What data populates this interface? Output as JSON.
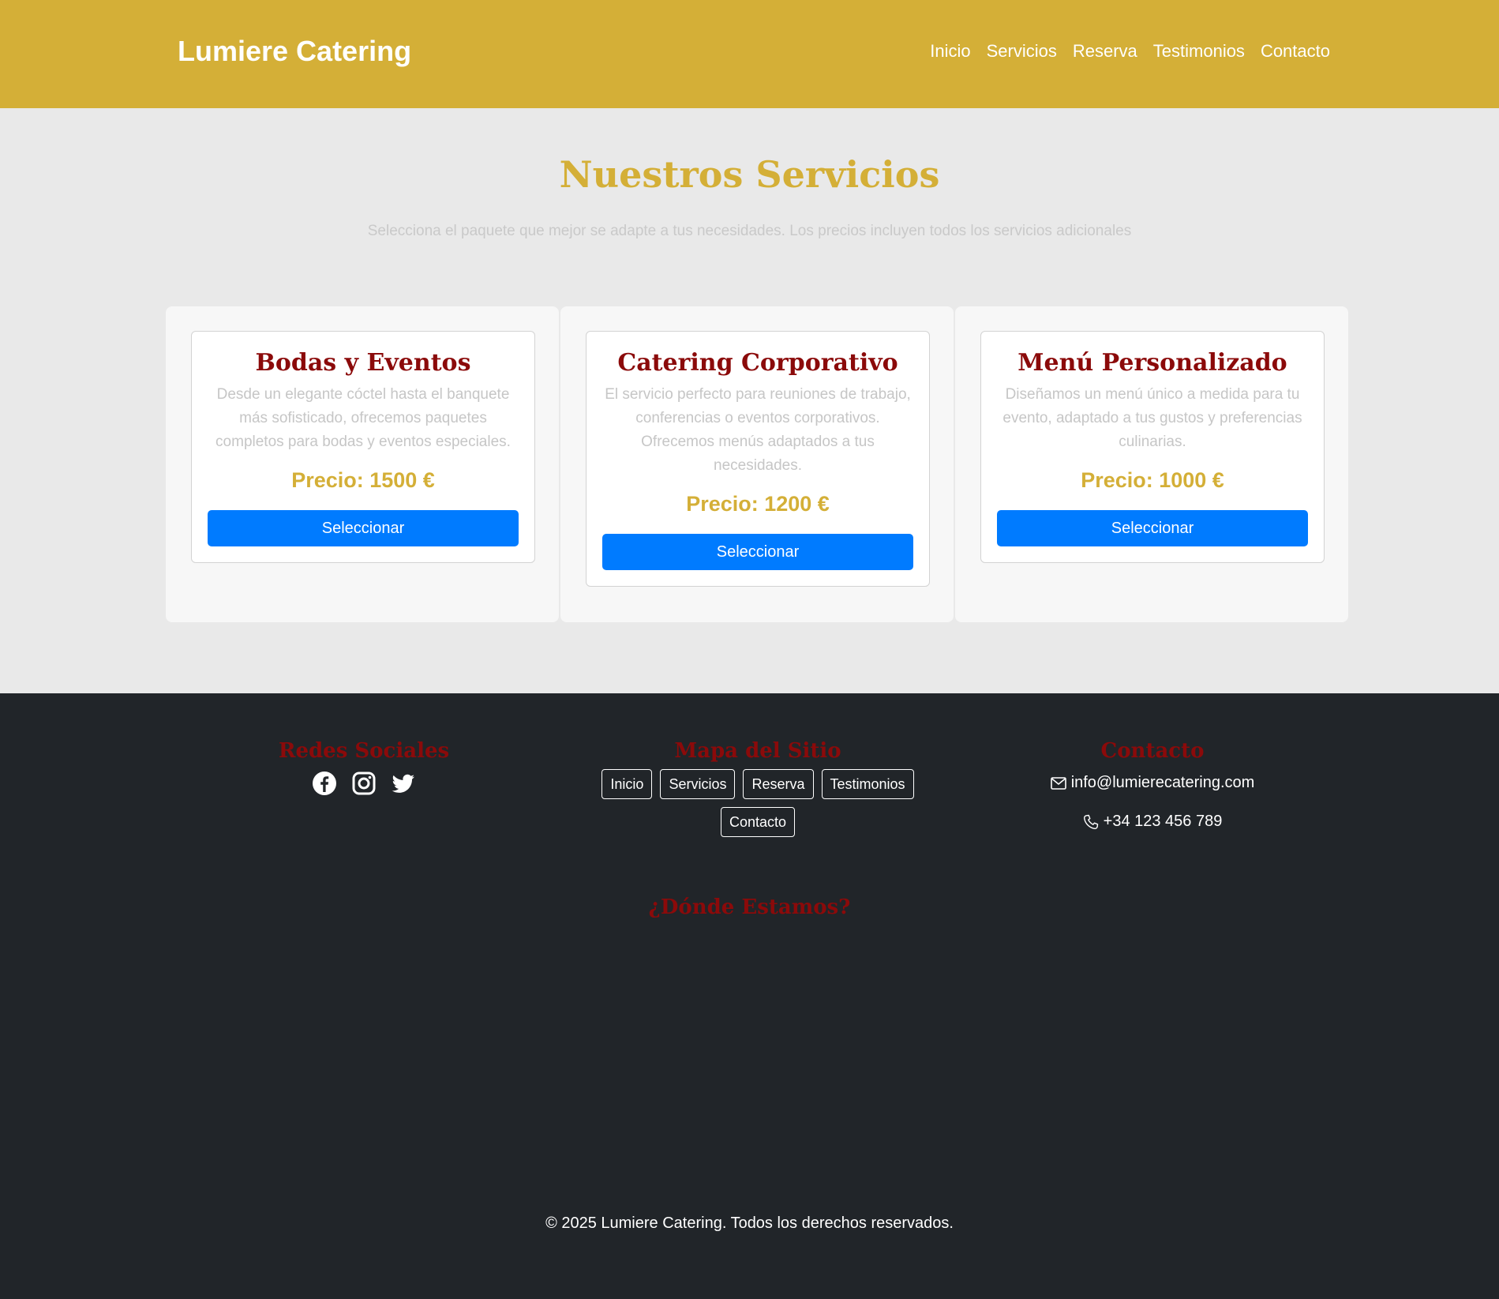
{
  "header": {
    "brand": "Lumiere Catering",
    "nav": [
      "Inicio",
      "Servicios",
      "Reserva",
      "Testimonios",
      "Contacto"
    ]
  },
  "services": {
    "title": "Nuestros Servicios",
    "subtitle": "Selecciona el paquete que mejor se adapte a tus necesidades. Los precios incluyen todos los servicios adicionales",
    "cards": [
      {
        "title": "Bodas y Eventos",
        "description": "Desde un elegante cóctel hasta el banquete más sofisticado, ofrecemos paquetes completos para bodas y eventos especiales.",
        "price": "Precio: 1500 €",
        "button": "Seleccionar"
      },
      {
        "title": "Catering Corporativo",
        "description": "El servicio perfecto para reuniones de trabajo, conferencias o eventos corporativos. Ofrecemos menús adaptados a tus necesidades.",
        "price": "Precio: 1200 €",
        "button": "Seleccionar"
      },
      {
        "title": "Menú Personalizado",
        "description": "Diseñamos un menú único a medida para tu evento, adaptado a tus gustos y preferencias culinarias.",
        "price": "Precio: 1000 €",
        "button": "Seleccionar"
      }
    ]
  },
  "footer": {
    "social_heading": "Redes Sociales",
    "social_icons": [
      "facebook-icon",
      "instagram-icon",
      "twitter-icon"
    ],
    "sitemap_heading": "Mapa del Sitio",
    "sitemap_links": [
      "Inicio",
      "Servicios",
      "Reserva",
      "Testimonios",
      "Contacto"
    ],
    "contact_heading": "Contacto",
    "email": "info@lumierecatering.com",
    "phone": "+34 123 456 789",
    "where_heading": "¿Dónde Estamos?",
    "copyright": "© 2025 Lumiere Catering. Todos los derechos reservados."
  },
  "colors": {
    "brand_gold": "#d4af37",
    "title_red": "#8b0a0a",
    "button_blue": "#007bff",
    "footer_bg": "#212529"
  }
}
